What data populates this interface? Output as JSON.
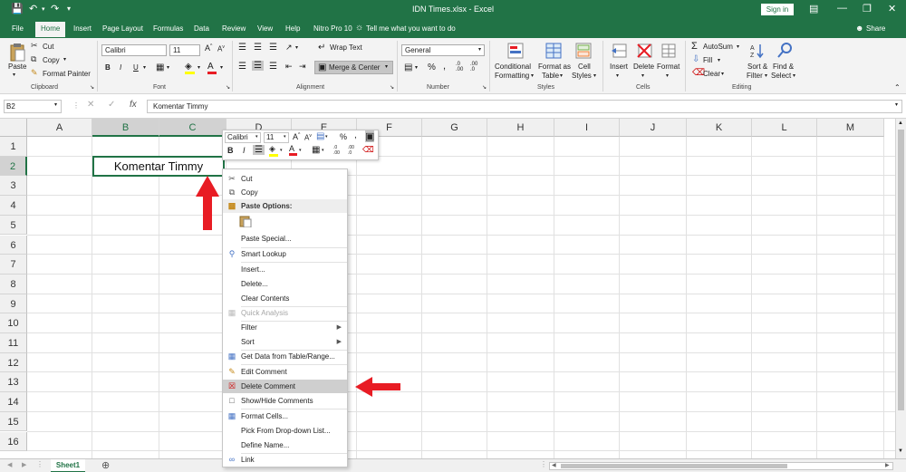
{
  "app": {
    "title": "IDN Times.xlsx  -  Excel",
    "signin_label": "Sign in",
    "share_label": "Share",
    "tell_me": "Tell me what you want to do"
  },
  "tabs": [
    "File",
    "Home",
    "Insert",
    "Page Layout",
    "Formulas",
    "Data",
    "Review",
    "View",
    "Help",
    "Nitro Pro 10"
  ],
  "ribbon": {
    "clipboard": {
      "paste": "Paste",
      "cut": "Cut",
      "copy": "Copy",
      "format_painter": "Format Painter",
      "label": "Clipboard"
    },
    "font": {
      "family": "Calibri",
      "size": "11",
      "label": "Font"
    },
    "alignment": {
      "wrap_text": "Wrap Text",
      "merge_center": "Merge & Center",
      "label": "Alignment"
    },
    "number": {
      "format": "General",
      "label": "Number"
    },
    "styles": {
      "conditional_formatting_1": "Conditional",
      "conditional_formatting_2": "Formatting",
      "format_as_table_1": "Format as",
      "format_as_table_2": "Table",
      "cell_styles_1": "Cell",
      "cell_styles_2": "Styles",
      "label": "Styles"
    },
    "cells": {
      "insert": "Insert",
      "delete": "Delete",
      "format": "Format",
      "label": "Cells"
    },
    "editing": {
      "autosum": "AutoSum",
      "fill": "Fill",
      "clear": "Clear",
      "sort_filter_1": "Sort &",
      "sort_filter_2": "Filter",
      "find_select_1": "Find &",
      "find_select_2": "Select",
      "label": "Editing"
    }
  },
  "formula_bar": {
    "name_box": "B2",
    "fx": "fx",
    "content": "Komentar Timmy"
  },
  "grid": {
    "columns": [
      "A",
      "B",
      "C",
      "D",
      "E",
      "F",
      "G",
      "H",
      "I",
      "J",
      "K",
      "L",
      "M"
    ],
    "rows": [
      "1",
      "2",
      "3",
      "4",
      "5",
      "6",
      "7",
      "8",
      "9",
      "10",
      "11",
      "12",
      "13",
      "14",
      "15",
      "16"
    ],
    "active_cell_value": "Komentar Timmy"
  },
  "sheets": [
    "Sheet1"
  ],
  "mini_toolbar": {
    "font": "Calibri",
    "size": "11",
    "percent": "%",
    "comma": ","
  },
  "context_menu": {
    "items": [
      {
        "label": "Cut",
        "icon": "scissors-icon"
      },
      {
        "label": "Copy",
        "icon": "copy-icon"
      },
      {
        "label": "Paste Options:",
        "icon": "paste-icon"
      },
      {
        "label": "Paste Special...",
        "icon": ""
      },
      {
        "label": "Smart Lookup",
        "icon": "search-icon"
      },
      {
        "label": "Insert...",
        "icon": ""
      },
      {
        "label": "Delete...",
        "icon": ""
      },
      {
        "label": "Clear Contents",
        "icon": ""
      },
      {
        "label": "Quick Analysis",
        "icon": "quick-analysis-icon"
      },
      {
        "label": "Filter",
        "icon": ""
      },
      {
        "label": "Sort",
        "icon": ""
      },
      {
        "label": "Get Data from Table/Range...",
        "icon": "table-icon"
      },
      {
        "label": "Edit Comment",
        "icon": "edit-comment-icon"
      },
      {
        "label": "Delete Comment",
        "icon": "delete-comment-icon"
      },
      {
        "label": "Show/Hide Comments",
        "icon": "comments-icon"
      },
      {
        "label": "Format Cells...",
        "icon": "format-cells-icon"
      },
      {
        "label": "Pick From Drop-down List...",
        "icon": ""
      },
      {
        "label": "Define Name...",
        "icon": ""
      },
      {
        "label": "Link",
        "icon": "link-icon"
      }
    ]
  },
  "colors": {
    "excel_green": "#217346",
    "highlight": "#cfcfcf",
    "arrow_red": "#e81c24"
  }
}
